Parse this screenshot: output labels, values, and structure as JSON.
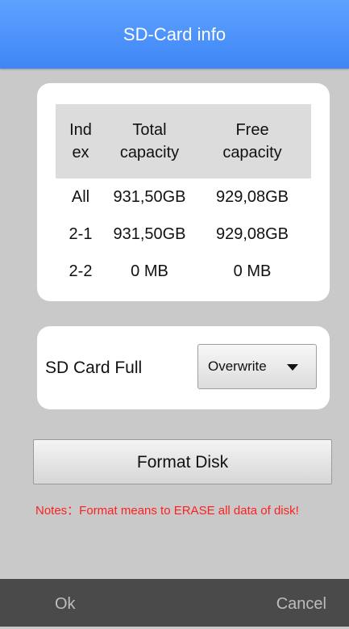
{
  "dialog": {
    "title": "SD-Card info"
  },
  "capacity_table": {
    "headers": [
      [
        "Ind",
        "ex"
      ],
      [
        "Total",
        "capacity"
      ],
      [
        "Free",
        "capacity"
      ]
    ],
    "rows": [
      {
        "index": "All",
        "total": "931,50GB",
        "free": "929,08GB"
      },
      {
        "index": "2-1",
        "total": "931,50GB",
        "free": "929,08GB"
      },
      {
        "index": "2-2",
        "total": "0 MB",
        "free": "0 MB"
      }
    ]
  },
  "sd_card_full": {
    "label": "SD Card Full",
    "selected": "Overwrite"
  },
  "format_button": {
    "label": "Format Disk"
  },
  "notes": "Notes：Format means to ERASE all data of disk!",
  "footer": {
    "ok_label": "Ok",
    "cancel_label": "Cancel"
  },
  "colors": {
    "header": "#4a90ff",
    "background": "#c9c9c9",
    "notes": "#ff1f1f",
    "footer": "#4a4a4a"
  },
  "icons": {
    "dropdown": "triangle-down-icon"
  }
}
